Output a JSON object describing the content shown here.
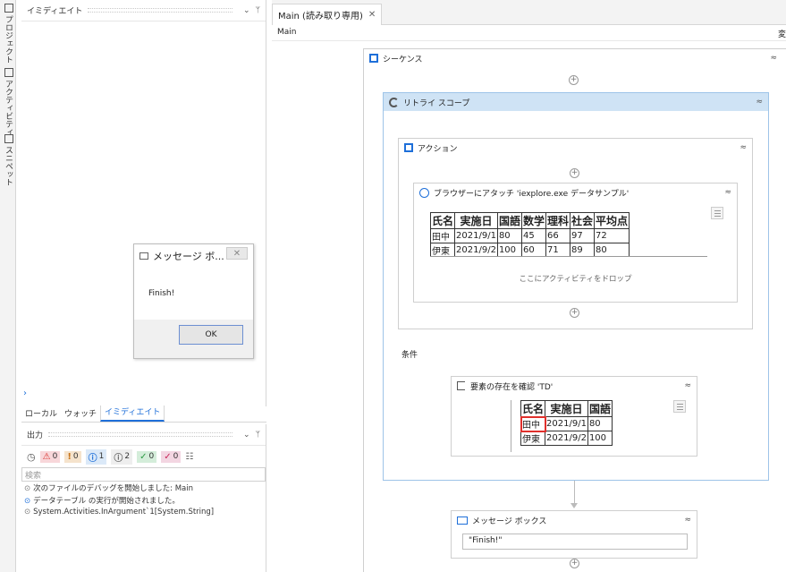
{
  "rail": {
    "items": [
      {
        "label": "プロジェクト",
        "icon": "project-icon"
      },
      {
        "label": "アクティビティ",
        "icon": "activities-icon"
      },
      {
        "label": "スニペット",
        "icon": "snippets-icon"
      }
    ]
  },
  "immediate_panel": {
    "title": "イミディエイト",
    "dropdown": "⌄",
    "pin": "ᛘ",
    "prompt": "›"
  },
  "local_tabs": [
    "ローカル",
    "ウォッチ",
    "イミディエイト"
  ],
  "output_panel": {
    "title": "出力",
    "badges": [
      {
        "count": "0",
        "glyph": "⚠"
      },
      {
        "count": "0",
        "glyph": "!"
      },
      {
        "count": "1",
        "glyph": "ⓘ"
      },
      {
        "count": "2",
        "glyph": "ⓘ"
      },
      {
        "count": "0",
        "glyph": "✓"
      },
      {
        "count": "0",
        "glyph": "✓"
      }
    ],
    "search_placeholder": "検索",
    "logs": [
      "次のファイルのデバッグを開始しました: Main",
      "データテーブル の実行が開始されました。",
      "System.Activities.InArgument`1[System.String]"
    ]
  },
  "message_dialog": {
    "title": "メッセージ ボ...",
    "close": "✕",
    "message": "Finish!",
    "ok_label": "OK"
  },
  "designer": {
    "tab_label": "Main (読み取り専用)",
    "tab_close": "✕",
    "breadcrumb": "Main",
    "breadcrumb_right": "変",
    "sequence_title": "シーケンス",
    "retry_scope_title": "リトライ スコープ",
    "action_title": "アクション",
    "attach_title": "ブラウザーにアタッチ 'iexplore.exe  データサンプル'",
    "drop_hint": "ここにアクティビティをドロップ",
    "condition_label": "条件",
    "element_exists_title": "要素の存在を確認 'TD'",
    "message_box_title": "メッセージ ボックス",
    "message_box_value": "\"Finish!\"",
    "collapse_glyph": "≈",
    "plus": "+"
  },
  "browser_table": {
    "headers": [
      "氏名",
      "実施日",
      "国語",
      "数学",
      "理科",
      "社会",
      "平均点"
    ],
    "rows": [
      [
        "田中",
        "2021/9/1",
        "80",
        "45",
        "66",
        "97",
        "72"
      ],
      [
        "伊東",
        "2021/9/2",
        "100",
        "60",
        "71",
        "89",
        "80"
      ]
    ]
  },
  "element_table": {
    "headers": [
      "氏名",
      "実施日",
      "国語"
    ],
    "rows": [
      [
        "田中",
        "2021/9/1",
        "80"
      ],
      [
        "伊東",
        "2021/9/2",
        "100"
      ]
    ]
  }
}
